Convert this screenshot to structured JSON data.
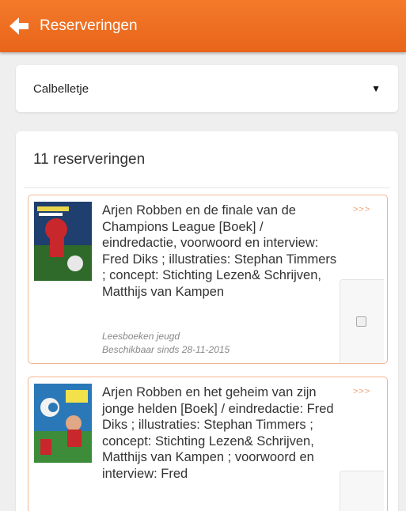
{
  "header": {
    "title": "Reserveringen",
    "back_icon": "arrow-left-icon"
  },
  "location_select": {
    "selected": "Calbelletje"
  },
  "reservations": {
    "count_label": "11 reserveringen",
    "items": [
      {
        "title": "Arjen Robben en de finale van de Champions League [Boek] / eindredactie, voorwoord en interview: Fred Diks ; illustraties: Stephan Timmers ; concept: Stichting Lezen& Schrijven, Matthijs van Kampen",
        "category": "Leesboeken jeugd",
        "availability": "Beschikbaar sinds 28-11-2015",
        "more_label": ">>>"
      },
      {
        "title": "Arjen Robben en het geheim van zijn jonge helden [Boek] / eindredactie: Fred Diks ; illustraties: Stephan Timmers ; concept: Stichting Lezen& Schrijven, Matthijs van Kampen ; voorwoord en interview: Fred",
        "more_label": ">>>"
      }
    ]
  },
  "colors": {
    "accent": "#ee6d22",
    "item_border": "#f3b58f",
    "background": "#efefef"
  }
}
